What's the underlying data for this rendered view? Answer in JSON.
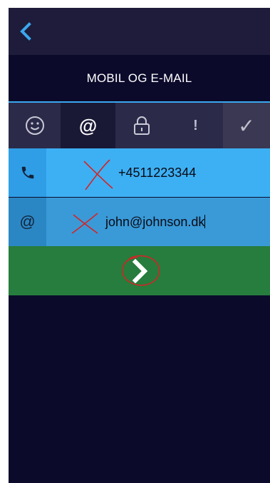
{
  "header": {
    "back_icon": "chevron-left-icon",
    "title": "MOBIL OG E-MAIL"
  },
  "tabs": [
    {
      "icon": "smiley-icon",
      "glyph": "☺"
    },
    {
      "icon": "at-icon",
      "glyph": "@"
    },
    {
      "icon": "lock-icon",
      "glyph": ""
    },
    {
      "icon": "exclamation-icon",
      "glyph": "!"
    },
    {
      "icon": "checkmark-icon",
      "glyph": "✓"
    }
  ],
  "form": {
    "phone": {
      "icon": "phone-icon",
      "value": "+4511223344"
    },
    "email": {
      "icon": "at-icon",
      "icon_glyph": "@",
      "value": "john@johnson.dk"
    }
  },
  "next": {
    "icon": "chevron-right-icon"
  },
  "colors": {
    "background": "#0b0a2b",
    "accent_blue": "#3db0f4",
    "next_green": "#267d3d",
    "annotation_red": "#d42424"
  }
}
